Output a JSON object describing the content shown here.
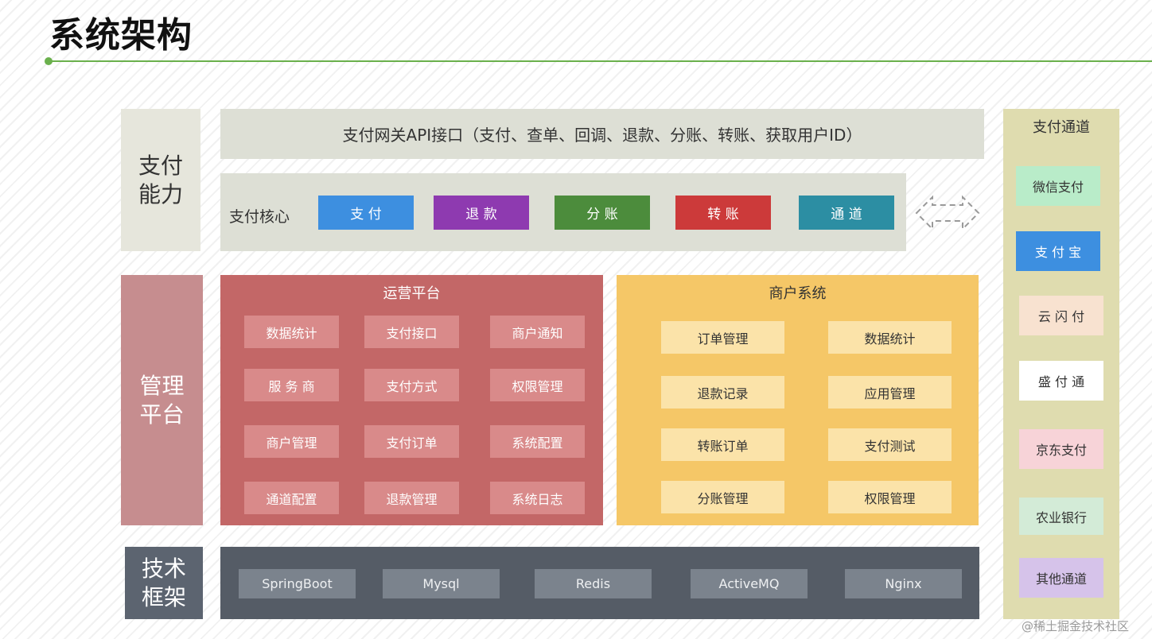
{
  "title": "系统架构",
  "layers": {
    "payment_capability": "支付\n能力",
    "management_platform": "管理\n平台",
    "tech_framework": "技术\n框架"
  },
  "gateway": {
    "label": "支付网关API接口（支付、查单、回调、退款、分账、转账、获取用户ID）"
  },
  "payment_core": {
    "label": "支付核心",
    "modules": [
      {
        "label": "支 付",
        "color": "#3d8fe0"
      },
      {
        "label": "退 款",
        "color": "#8e3ab0"
      },
      {
        "label": "分 账",
        "color": "#4c8c3c"
      },
      {
        "label": "转 账",
        "color": "#cc3a3a"
      },
      {
        "label": "通 道",
        "color": "#2c8ea3"
      }
    ]
  },
  "operations_platform": {
    "title": "运营平台",
    "items": [
      "数据统计",
      "支付接口",
      "商户通知",
      "服 务 商",
      "支付方式",
      "权限管理",
      "商户管理",
      "支付订单",
      "系统配置",
      "通道配置",
      "退款管理",
      "系统日志"
    ]
  },
  "merchant_system": {
    "title": "商户系统",
    "items": [
      "订单管理",
      "数据统计",
      "退款记录",
      "应用管理",
      "转账订单",
      "支付测试",
      "分账管理",
      "权限管理"
    ]
  },
  "tech_stack": [
    "SpringBoot",
    "Mysql",
    "Redis",
    "ActiveMQ",
    "Nginx"
  ],
  "channels": {
    "title": "支付通道",
    "items": [
      {
        "label": "微信支付",
        "bg": "#b9ecc9"
      },
      {
        "label": "支 付 宝",
        "bg": "#3d8fe0"
      },
      {
        "label": "云 闪 付",
        "bg": "#f8e2d0"
      },
      {
        "label": "盛 付 通",
        "bg": "#ffffff"
      },
      {
        "label": "京东支付",
        "bg": "#f7d3d8"
      },
      {
        "label": "农业银行",
        "bg": "#d3ebd7"
      },
      {
        "label": "其他通道",
        "bg": "#d6c3ea"
      }
    ]
  },
  "watermark": "@稀土掘金技术社区"
}
